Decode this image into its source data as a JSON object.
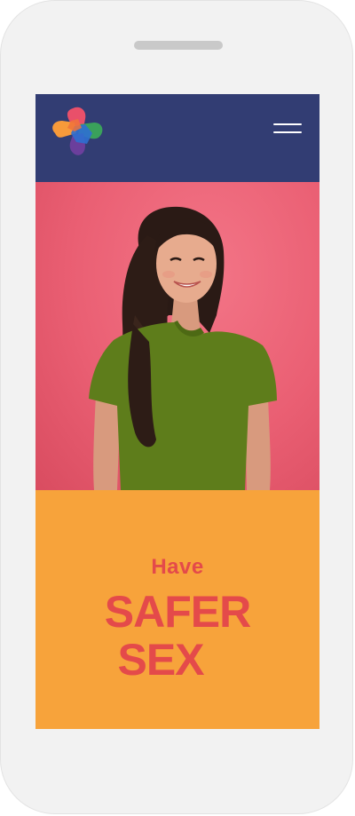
{
  "header": {
    "logo_icon": "cross-logo-icon",
    "menu_icon": "hamburger-menu-icon"
  },
  "hero": {
    "image": "smiling-woman-green-tshirt-photo"
  },
  "promo": {
    "line1": "Have",
    "line2": "SAFER",
    "line3": "SEX"
  },
  "colors": {
    "header_bg": "#323d73",
    "hero_bg": "#ea5f73",
    "promo_bg": "#f7a33b",
    "promo_text": "#e44a4a"
  }
}
